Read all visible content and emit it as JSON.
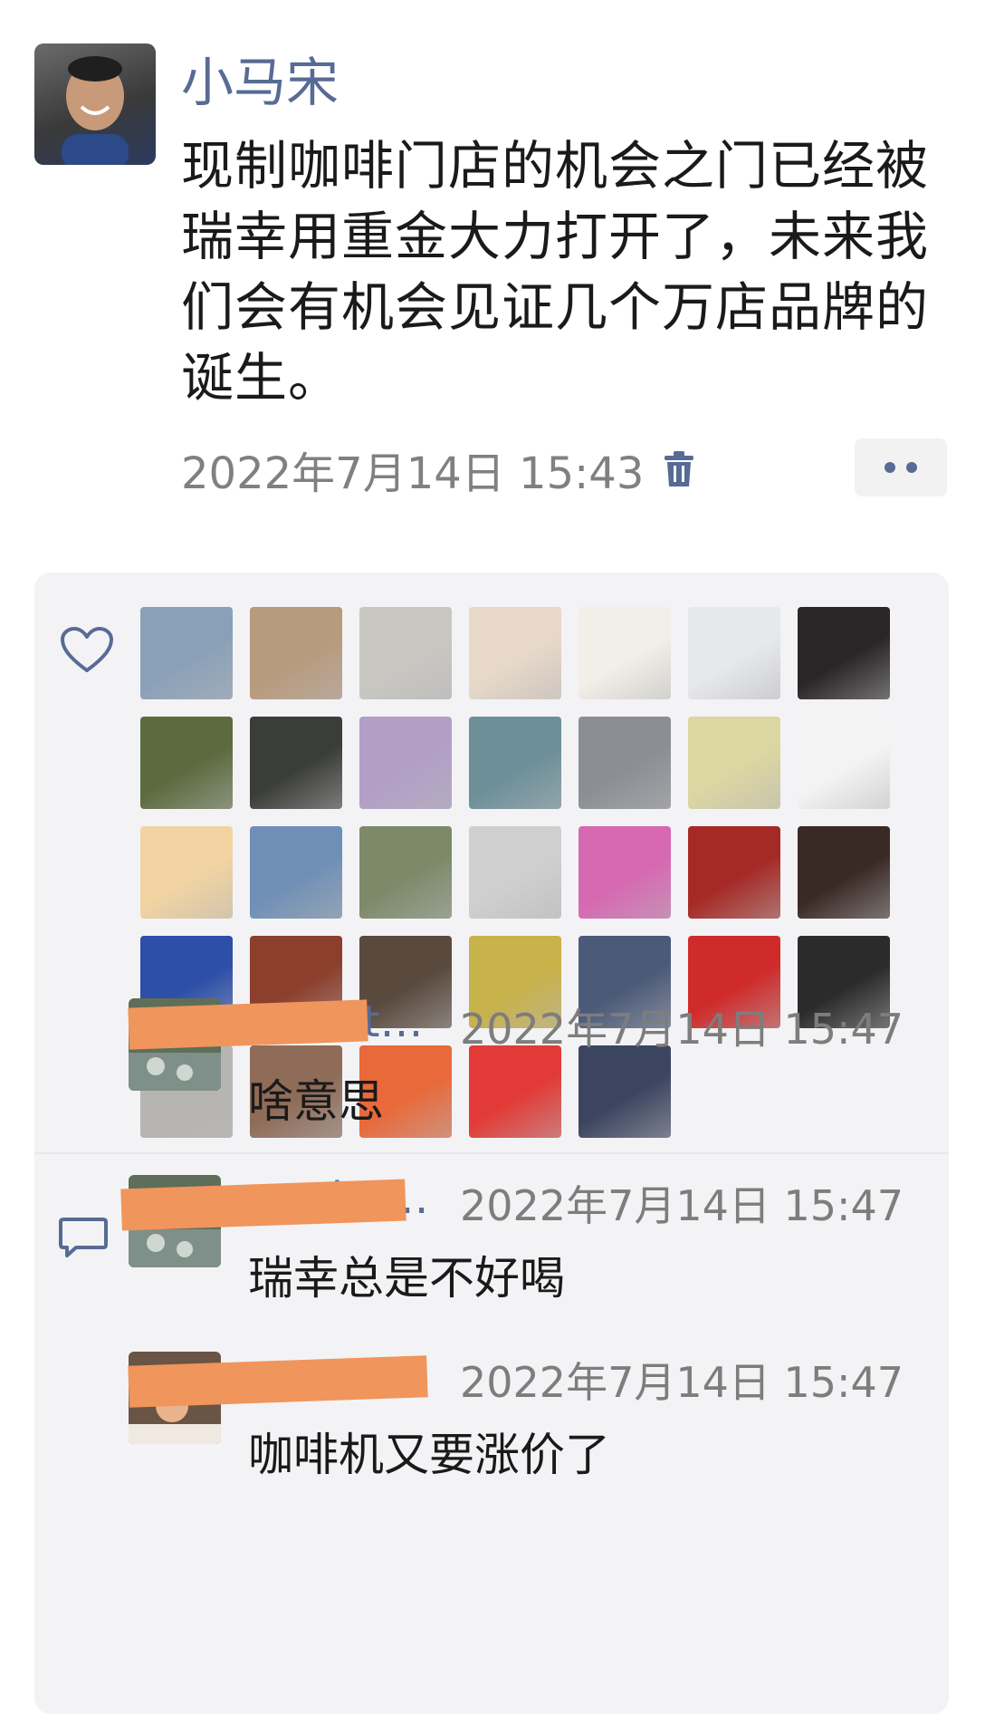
{
  "post": {
    "author": "小马宋",
    "text": "现制咖啡门店的机会之门已经被瑞幸用重金大力打开了，未来我们会有机会见证几个万店品牌的诞生。",
    "timestamp": "2022年7月14日 15:43",
    "icons": {
      "delete": "trash-icon",
      "more": "more-dots-icon"
    }
  },
  "likes": {
    "icon": "heart-icon",
    "avatars": [
      {
        "color": "#8aa0b8"
      },
      {
        "color": "#b89a7c"
      },
      {
        "color": "#c9c7c2"
      },
      {
        "color": "#e7d8c9"
      },
      {
        "color": "#f2efe8"
      },
      {
        "color": "#e6e8ec"
      },
      {
        "color": "#2a2526"
      },
      {
        "color": "#5c6b3f"
      },
      {
        "color": "#3b3d39"
      },
      {
        "color": "#b29fc8"
      },
      {
        "color": "#6c8f99"
      },
      {
        "color": "#8b8f94"
      },
      {
        "color": "#dcd6a2"
      },
      {
        "color": "#f3f3f3"
      },
      {
        "color": "#f1d4a2"
      },
      {
        "color": "#6f8fb6"
      },
      {
        "color": "#7d8a6a"
      },
      {
        "color": "#cfcfcf"
      },
      {
        "color": "#d768b2"
      },
      {
        "color": "#a52a26"
      },
      {
        "color": "#3a2a26"
      },
      {
        "color": "#2d4fa8"
      },
      {
        "color": "#8c3f2c"
      },
      {
        "color": "#5a4a3e"
      },
      {
        "color": "#c8b24a"
      },
      {
        "color": "#4b5a78"
      },
      {
        "color": "#cf2b2b"
      },
      {
        "color": "#2b2b2b"
      },
      {
        "color": "#b7b5b2"
      },
      {
        "color": "#8f6c58"
      },
      {
        "color": "#e9693a"
      },
      {
        "color": "#e23b37"
      },
      {
        "color": "#3c4560"
      }
    ]
  },
  "comments": {
    "icon": "comment-icon",
    "items": [
      {
        "name": "…thats…",
        "time": "2022年7月14日 15:47",
        "text": "啥意思",
        "avatar_color": "#5e6e58"
      },
      {
        "name": "…sthats…",
        "time": "2022年7月14日 15:47",
        "text": "瑞幸总是不好喝",
        "avatar_color": "#5e6e58"
      },
      {
        "name": "…",
        "time": "2022年7月14日 15:47",
        "text": "咖啡机又要涨价了",
        "avatar_color": "#6a5446"
      }
    ]
  }
}
